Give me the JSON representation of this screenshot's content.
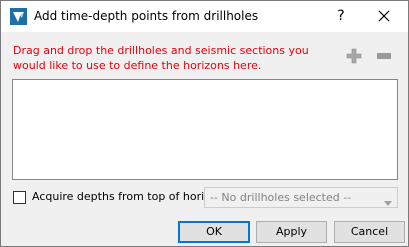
{
  "window": {
    "title": "Add time-depth points from drillholes",
    "help_label": "?",
    "icons": {
      "app": "app-logo-icon",
      "close": "close-icon"
    }
  },
  "instruction": "Drag and drop the drillholes and seismic sections you would like to use to define the horizons here.",
  "toolbar": {
    "add_icon": "plus-icon",
    "remove_icon": "minus-icon"
  },
  "options": {
    "acquire_depths_label": "Acquire depths from top of horizon",
    "acquire_depths_checked": false,
    "drillhole_combo_value": "-- No drillholes selected --",
    "drillhole_combo_enabled": false
  },
  "buttons": {
    "ok": "OK",
    "apply": "Apply",
    "cancel": "Cancel"
  },
  "colors": {
    "instruction_text": "#e8000c",
    "default_button_border": "#0078d7",
    "dialog_background": "#f0f0f0"
  }
}
